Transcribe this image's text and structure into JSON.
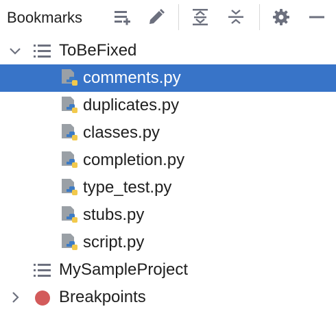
{
  "panel": {
    "title": "Bookmarks"
  },
  "toolbar": {
    "buttons": [
      {
        "name": "add-bookmark-list-button",
        "icon": "add-list-icon"
      },
      {
        "name": "edit-button",
        "icon": "pencil-icon"
      },
      {
        "name": "expand-all-button",
        "icon": "expand-all-icon"
      },
      {
        "name": "collapse-all-button",
        "icon": "collapse-all-icon"
      },
      {
        "name": "settings-button",
        "icon": "gear-icon"
      },
      {
        "name": "minimize-button",
        "icon": "minus-icon"
      }
    ]
  },
  "tree": {
    "groups": [
      {
        "label": "ToBeFixed",
        "expanded": true,
        "icon": "list-icon",
        "files": [
          {
            "label": "comments.py",
            "selected": true,
            "icon": "python-file-icon"
          },
          {
            "label": "duplicates.py",
            "selected": false,
            "icon": "python-file-icon"
          },
          {
            "label": "classes.py",
            "selected": false,
            "icon": "python-file-icon"
          },
          {
            "label": "completion.py",
            "selected": false,
            "icon": "python-file-icon"
          },
          {
            "label": "type_test.py",
            "selected": false,
            "icon": "python-file-icon"
          },
          {
            "label": "stubs.py",
            "selected": false,
            "icon": "python-file-icon"
          },
          {
            "label": "script.py",
            "selected": false,
            "icon": "python-file-icon"
          }
        ]
      },
      {
        "label": "MySampleProject",
        "expanded": false,
        "icon": "list-icon"
      },
      {
        "label": "Breakpoints",
        "expanded": false,
        "icon": "breakpoint-dot-icon"
      }
    ]
  },
  "colors": {
    "selection": "#3874c8",
    "icon_gray": "#6c707e",
    "breakpoint_red": "#d35b5b",
    "python_blue": "#3d7bc4",
    "python_yellow": "#f2c94c"
  }
}
